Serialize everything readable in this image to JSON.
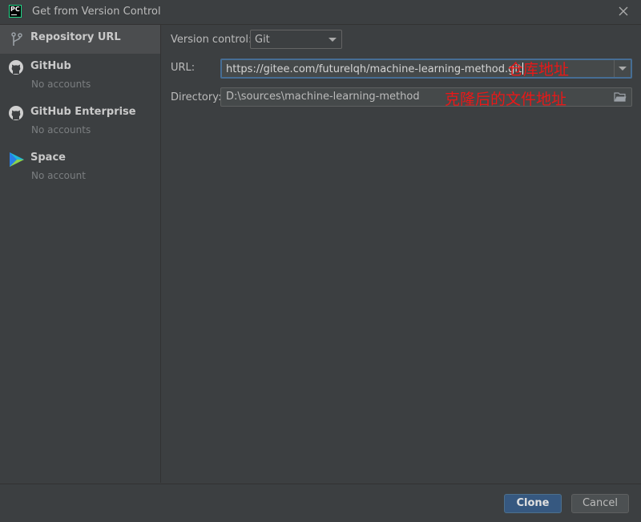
{
  "window": {
    "app_icon_text": "PC",
    "title": "Get from Version Control"
  },
  "sidebar": {
    "items": [
      {
        "label": "Repository URL",
        "sublabel": ""
      },
      {
        "label": "GitHub",
        "sublabel": "No accounts"
      },
      {
        "label": "GitHub Enterprise",
        "sublabel": "No accounts"
      },
      {
        "label": "Space",
        "sublabel": "No account"
      }
    ]
  },
  "form": {
    "version_control_label": "Version control:",
    "version_control_value": "Git",
    "url_label": "URL:",
    "url_value": "https://gitee.com/futurelqh/machine-learning-method.git",
    "directory_label": "Directory:",
    "directory_value": "D:\\sources\\machine-learning-method"
  },
  "annotations": {
    "url_note": "仓库地址",
    "directory_note": "克隆后的文件地址",
    "color": "#e81818"
  },
  "buttons": {
    "clone": "Clone",
    "cancel": "Cancel"
  },
  "colors": {
    "background": "#3c3f41",
    "selected": "#4b4d4f",
    "primary_button": "#365880",
    "focus_border": "#466d94"
  }
}
